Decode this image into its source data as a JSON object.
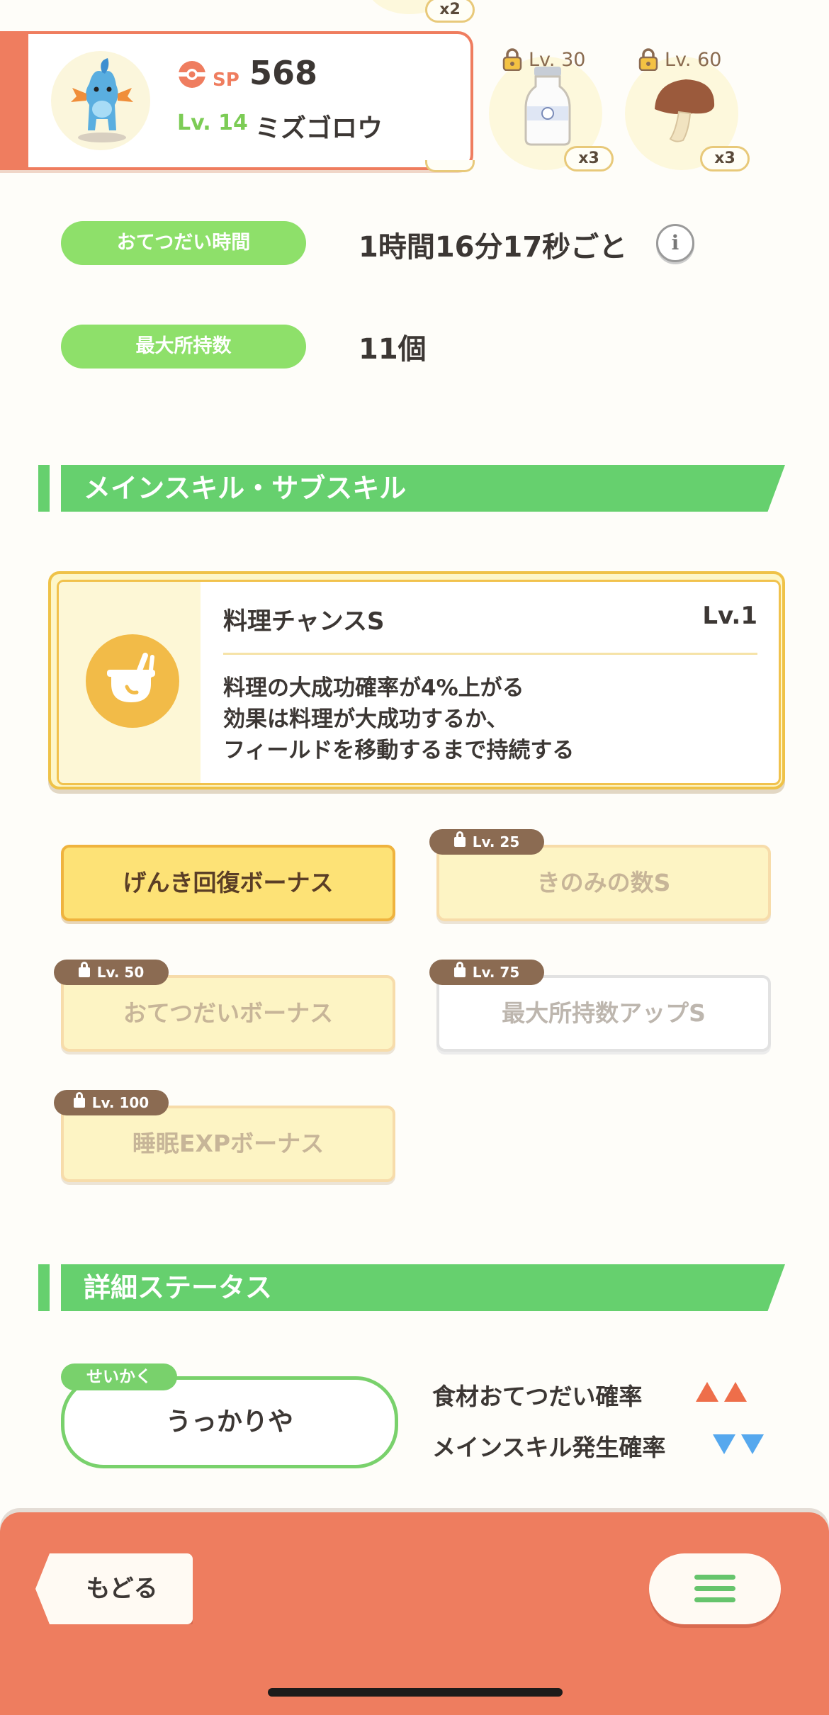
{
  "header": {
    "top_badge": "x2",
    "pokemon": {
      "sp_label": "SP",
      "sp_value": "568",
      "level_label": "Lv. 14",
      "name": "ミズゴロウ"
    },
    "ingredients": [
      {
        "lock_level": "Lv. 30",
        "quantity": "x3",
        "icon": "milk-bottle-icon"
      },
      {
        "lock_level": "Lv. 60",
        "quantity": "x3",
        "icon": "mushroom-icon"
      }
    ]
  },
  "info": {
    "help_time_label": "おてつだい時間",
    "help_time_value": "1時間16分17秒ごと",
    "info_icon": "i",
    "max_carry_label": "最大所持数",
    "max_carry_value": "11個"
  },
  "skills_section": {
    "title": "メインスキル・サブスキル",
    "main_skill": {
      "name": "料理チャンスS",
      "level": "Lv.1",
      "description": [
        "料理の大成功確率が4%上がる",
        "効果は料理が大成功するか、",
        "フィールドを移動するまで持続する"
      ],
      "icon": "cooking-pot-icon"
    },
    "sub_skills": [
      {
        "label": "げんき回復ボーナス",
        "lock": ""
      },
      {
        "label": "きのみの数S",
        "lock": "Lv. 25"
      },
      {
        "label": "おてつだいボーナス",
        "lock": "Lv. 50"
      },
      {
        "label": "最大所持数アップS",
        "lock": "Lv. 75"
      },
      {
        "label": "睡眠EXPボーナス",
        "lock": "Lv. 100"
      }
    ]
  },
  "status_section": {
    "title": "詳細ステータス",
    "nature_tag": "せいかく",
    "nature_value": "うっかりや",
    "effects": [
      {
        "label": "食材おてつだい確率",
        "direction": "up",
        "color": "#ee6e4a"
      },
      {
        "label": "メインスキル発生確率",
        "direction": "down",
        "color": "#56a8ee"
      }
    ]
  },
  "footer": {
    "back_label": "もどる",
    "menu_icon": "hamburger-menu-icon"
  },
  "colors": {
    "accent": "#ef7d5f",
    "green": "#66d06e",
    "gold": "#efc248"
  }
}
